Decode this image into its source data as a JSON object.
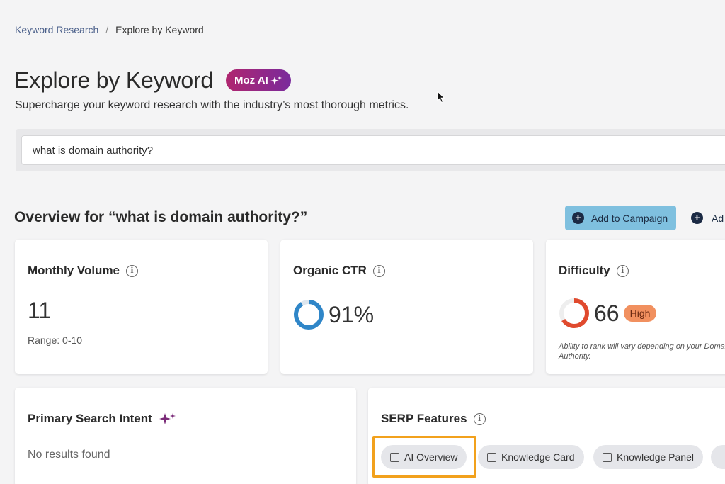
{
  "breadcrumb": {
    "parent": "Keyword Research",
    "separator": "/",
    "current": "Explore by Keyword"
  },
  "header": {
    "title": "Explore by Keyword",
    "badge": "Moz AI",
    "badge_icon": "sparkle-icon",
    "subtitle": "Supercharge your keyword research with the industry’s most thorough metrics."
  },
  "search": {
    "value": "what is domain authority?"
  },
  "overview": {
    "title": "Overview for “what is domain authority?”",
    "add_campaign_label": "Add to Campaign",
    "add_more_label": "Ad"
  },
  "metrics": {
    "monthly_volume": {
      "label": "Monthly Volume",
      "value": "11",
      "range": "Range: 0-10"
    },
    "organic_ctr": {
      "label": "Organic CTR",
      "value": "91%",
      "fraction": 0.91,
      "color": "#2f86c8"
    },
    "difficulty": {
      "label": "Difficulty",
      "value": "66",
      "fraction": 0.66,
      "color": "#e04a2e",
      "badge": "High",
      "note": "Ability to rank will vary depending on your Domain Authority."
    }
  },
  "intent": {
    "label": "Primary Search Intent",
    "empty": "No results found"
  },
  "serp": {
    "label": "SERP Features",
    "chips": [
      "AI Overview",
      "Knowledge Card",
      "Knowledge Panel"
    ]
  },
  "colors": {
    "accent_blue": "#7fc0df",
    "badge_gradient_start": "#b0266f",
    "badge_gradient_end": "#7a2a9c",
    "highlight": "#f2a11c"
  }
}
